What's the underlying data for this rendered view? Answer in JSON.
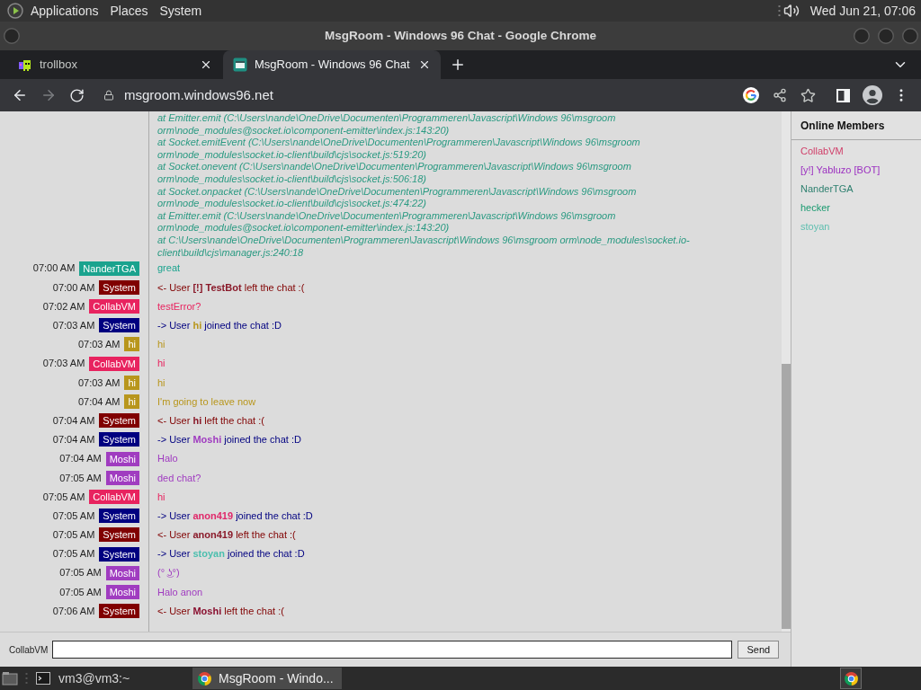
{
  "top_panel": {
    "menus": [
      "Applications",
      "Places",
      "System"
    ],
    "clock": "Wed Jun 21, 07:06"
  },
  "window": {
    "title": "MsgRoom - Windows 96 Chat - Google Chrome"
  },
  "browser": {
    "tabs": [
      {
        "label": "trollbox",
        "selected": false
      },
      {
        "label": "MsgRoom - Windows 96 Chat",
        "selected": true
      }
    ],
    "forward_disabled": true,
    "url": "msgroom.windows96.net"
  },
  "chat": {
    "error_trace": [
      "at Emitter.emit (C:\\Users\\nande\\OneDrive\\Documenten\\Programmeren\\Javascript\\Windows 96\\msgroom orm\\node_modules@socket.io\\component-emitter\\index.js:143:20)",
      "at Socket.emitEvent (C:\\Users\\nande\\OneDrive\\Documenten\\Programmeren\\Javascript\\Windows 96\\msgroom orm\\node_modules\\socket.io-client\\build\\cjs\\socket.js:519:20)",
      "at Socket.onevent (C:\\Users\\nande\\OneDrive\\Documenten\\Programmeren\\Javascript\\Windows 96\\msgroom orm\\node_modules\\socket.io-client\\build\\cjs\\socket.js:506:18)",
      "at Socket.onpacket (C:\\Users\\nande\\OneDrive\\Documenten\\Programmeren\\Javascript\\Windows 96\\msgroom orm\\node_modules\\socket.io-client\\build\\cjs\\socket.js:474:22)",
      "at Emitter.emit (C:\\Users\\nande\\OneDrive\\Documenten\\Programmeren\\Javascript\\Windows 96\\msgroom orm\\node_modules@socket.io\\component-emitter\\index.js:143:20)",
      "at C:\\Users\\nande\\OneDrive\\Documenten\\Programmeren\\Javascript\\Windows 96\\msgroom orm\\node_modules\\socket.io-client\\build\\cjs\\manager.js:240:18"
    ],
    "messages": [
      {
        "time": "07:00 AM",
        "user": "NanderTGA",
        "color": "#1aa38e",
        "kind": "chat",
        "text": "great"
      },
      {
        "time": "07:00 AM",
        "user": "System",
        "color": "#800000",
        "kind": "system",
        "prefix": "<- User",
        "name": {
          "text": "[!] TestBot",
          "color": "#8a1a2a"
        },
        "suffix": "left the chat :("
      },
      {
        "time": "07:02 AM",
        "user": "CollabVM",
        "color": "#e8235f",
        "kind": "chat",
        "text": "testError?"
      },
      {
        "time": "07:03 AM",
        "user": "System",
        "color": "#000080",
        "kind": "system",
        "prefix": "-> User",
        "name": {
          "text": "hi",
          "color": "#b8961c"
        },
        "suffix": "joined the chat :D"
      },
      {
        "time": "07:03 AM",
        "user": "hi",
        "color": "#b8961c",
        "kind": "chat",
        "text": "hi"
      },
      {
        "time": "07:03 AM",
        "user": "CollabVM",
        "color": "#e8235f",
        "kind": "chat",
        "text": "hi"
      },
      {
        "time": "07:03 AM",
        "user": "hi",
        "color": "#b8961c",
        "kind": "chat",
        "text": "hi"
      },
      {
        "time": "07:04 AM",
        "user": "hi",
        "color": "#b8961c",
        "kind": "chat",
        "text": "I'm going to leave now"
      },
      {
        "time": "07:04 AM",
        "user": "System",
        "color": "#800000",
        "kind": "system",
        "prefix": "<- User",
        "name": {
          "text": "hi",
          "color": "#8a1a2a"
        },
        "suffix": "left the chat :("
      },
      {
        "time": "07:04 AM",
        "user": "System",
        "color": "#000080",
        "kind": "system",
        "prefix": "-> User",
        "name": {
          "text": "Moshi",
          "color": "#a03cc0"
        },
        "suffix": "joined the chat :D"
      },
      {
        "time": "07:04 AM",
        "user": "Moshi",
        "color": "#a03cc0",
        "kind": "chat",
        "text": "Halo"
      },
      {
        "time": "07:05 AM",
        "user": "Moshi",
        "color": "#a03cc0",
        "kind": "chat",
        "text": "ded chat?"
      },
      {
        "time": "07:05 AM",
        "user": "CollabVM",
        "color": "#e8235f",
        "kind": "chat",
        "text": "hi"
      },
      {
        "time": "07:05 AM",
        "user": "System",
        "color": "#000080",
        "kind": "system",
        "prefix": "-> User",
        "name": {
          "text": "anon419",
          "color": "#e0286a"
        },
        "suffix": "joined the chat :D"
      },
      {
        "time": "07:05 AM",
        "user": "System",
        "color": "#800000",
        "kind": "system",
        "prefix": "<- User",
        "name": {
          "text": "anon419",
          "color": "#8a1a2a"
        },
        "suffix": "left the chat :("
      },
      {
        "time": "07:05 AM",
        "user": "System",
        "color": "#000080",
        "kind": "system",
        "prefix": "-> User",
        "name": {
          "text": "stoyan",
          "color": "#4bbfae"
        },
        "suffix": "joined the chat :D"
      },
      {
        "time": "07:05 AM",
        "user": "Moshi",
        "color": "#a03cc0",
        "kind": "chat",
        "text": "(° ͜ʖ°)"
      },
      {
        "time": "07:05 AM",
        "user": "Moshi",
        "color": "#a03cc0",
        "kind": "chat",
        "text": "Halo anon"
      },
      {
        "time": "07:06 AM",
        "user": "System",
        "color": "#800000",
        "kind": "system",
        "prefix": "<- User",
        "name": {
          "text": "Moshi",
          "color": "#8a1030"
        },
        "suffix": "left the chat :("
      }
    ]
  },
  "online_members": {
    "title": "Online Members",
    "members": [
      {
        "name": "CollabVM",
        "color": "#d0406a"
      },
      {
        "name": "[y!] Yabluzo [BOT]",
        "color": "#9b2fc0"
      },
      {
        "name": "NanderTGA",
        "color": "#2f8070"
      },
      {
        "name": "hecker",
        "color": "#1a9a70"
      },
      {
        "name": "stoyan",
        "color": "#5fbfb0"
      }
    ]
  },
  "composer": {
    "nickname": "CollabVM",
    "send_button": "Send"
  },
  "taskbar": {
    "items": [
      {
        "kind": "terminal",
        "label": "vm3@vm3:~",
        "selected": false
      },
      {
        "kind": "browser",
        "label": "MsgRoom - Windo...",
        "selected": true
      }
    ]
  }
}
